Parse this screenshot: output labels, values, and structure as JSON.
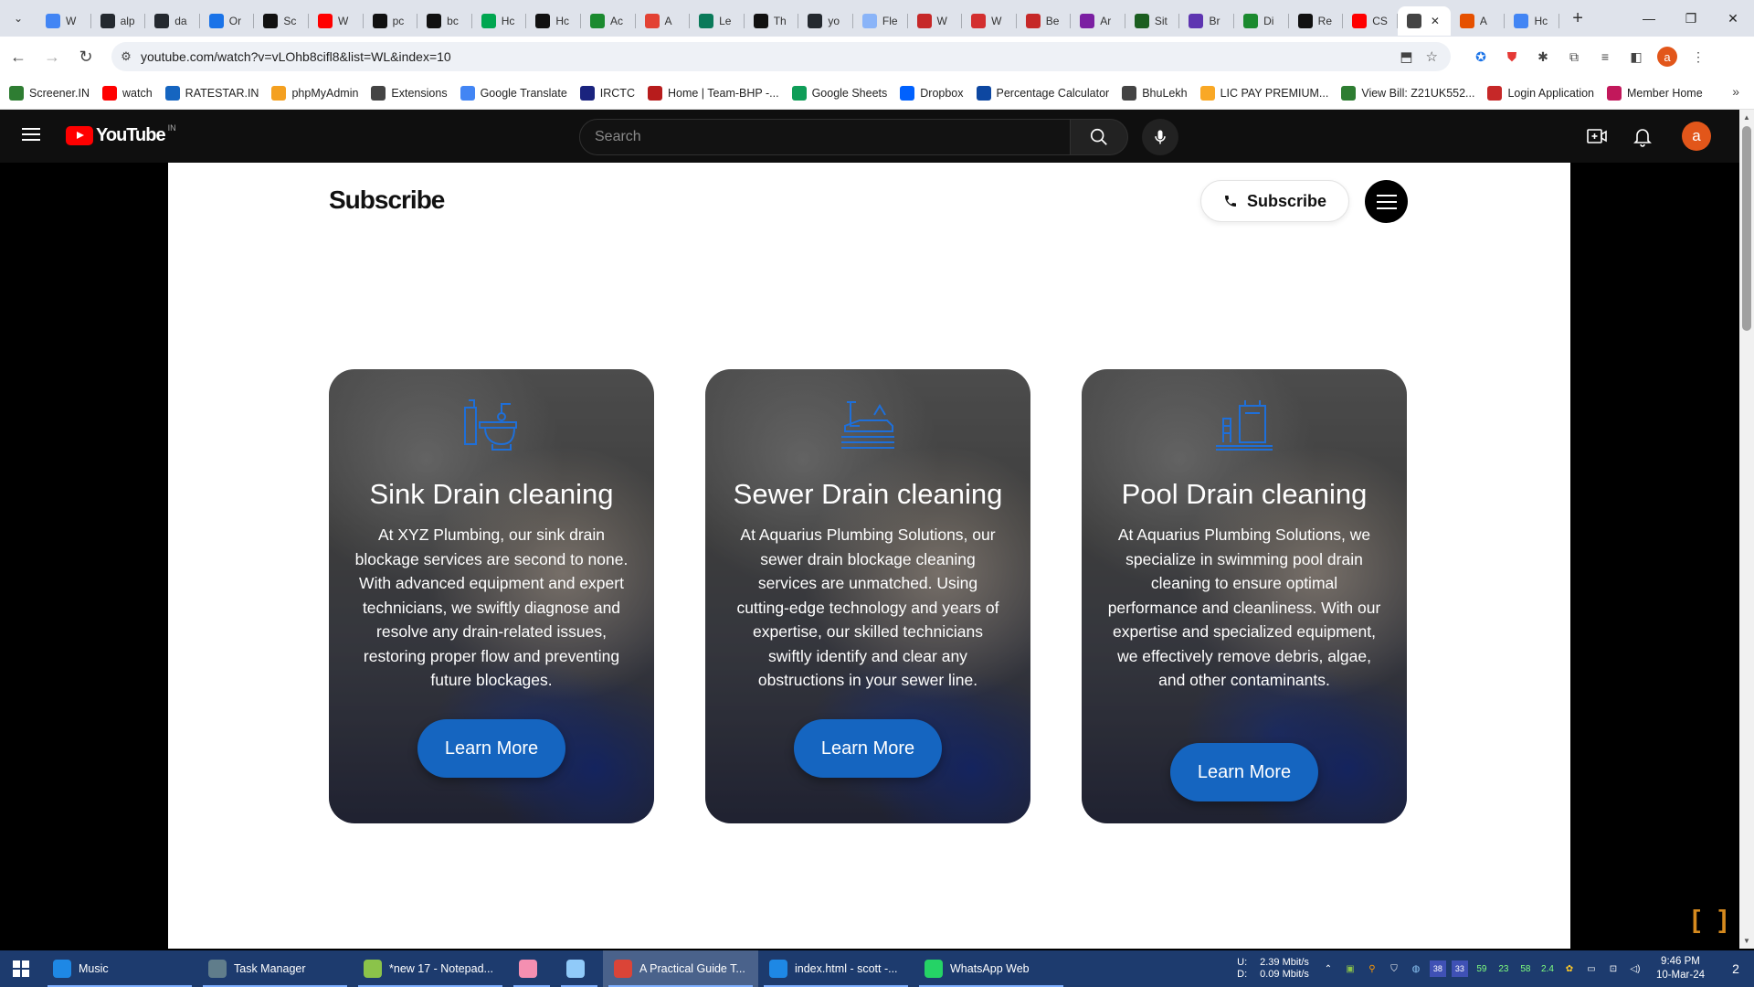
{
  "browser": {
    "tabs": [
      {
        "label": "W",
        "icon": "google-icon",
        "color": "#4285f4"
      },
      {
        "label": "alp",
        "icon": "github-icon",
        "color": "#24292f"
      },
      {
        "label": "da",
        "icon": "github-icon",
        "color": "#24292f"
      },
      {
        "label": "Or",
        "icon": "circle-a-icon",
        "color": "#1a73e8"
      },
      {
        "label": "Sc",
        "icon": "s-icon",
        "color": "#111111"
      },
      {
        "label": "W",
        "icon": "youtube-icon",
        "color": "#ff0000"
      },
      {
        "label": "pc",
        "icon": "medium-icon",
        "color": "#111111"
      },
      {
        "label": "bc",
        "icon": "medium-icon",
        "color": "#111111"
      },
      {
        "label": "Hc",
        "icon": "w-icon",
        "color": "#00a650"
      },
      {
        "label": "Hc",
        "icon": "a-icon",
        "color": "#111111"
      },
      {
        "label": "Ac",
        "icon": "link-icon",
        "color": "#1b8a2f"
      },
      {
        "label": "A",
        "icon": "star-icon",
        "color": "#e34234"
      },
      {
        "label": "Le",
        "icon": "leaf-icon",
        "color": "#0a7a5a"
      },
      {
        "label": "Th",
        "icon": "dev-icon",
        "color": "#111111"
      },
      {
        "label": "yo",
        "icon": "github-icon",
        "color": "#24292f"
      },
      {
        "label": "Fle",
        "icon": "swirl-icon",
        "color": "#8ab4f8"
      },
      {
        "label": "W",
        "icon": "nn-icon",
        "color": "#c62828"
      },
      {
        "label": "W",
        "icon": "ring-icon",
        "color": "#d32f2f"
      },
      {
        "label": "Be",
        "icon": "nn-icon",
        "color": "#c62828"
      },
      {
        "label": "Ar",
        "icon": "butterfly-icon",
        "color": "#7b1fa2"
      },
      {
        "label": "Sit",
        "icon": "n-icon",
        "color": "#1b5e20"
      },
      {
        "label": "Br",
        "icon": "b-icon",
        "color": "#5e35b1"
      },
      {
        "label": "Di",
        "icon": "link-icon",
        "color": "#1b8a2f"
      },
      {
        "label": "Re",
        "icon": "medium-icon",
        "color": "#111111"
      },
      {
        "label": "CS",
        "icon": "youtube-icon",
        "color": "#ff0000"
      },
      {
        "label": "",
        "icon": "speaker-icon",
        "color": "#444444",
        "active": true
      },
      {
        "label": "A",
        "icon": "html-icon",
        "color": "#e65100"
      },
      {
        "label": "Hc",
        "icon": "google-icon",
        "color": "#4285f4"
      }
    ],
    "active_tab_close": "✕",
    "new_tab": "+",
    "window_controls": {
      "minimize": "—",
      "maximize": "❐",
      "close": "✕"
    },
    "url": "youtube.com/watch?v=vLOhb8cifl8&list=WL&index=10",
    "bookmarks": [
      {
        "label": "Screener.IN",
        "icon": "bars-icon",
        "color": "#2e7d32"
      },
      {
        "label": "watch",
        "icon": "youtube-icon",
        "color": "#ff0000"
      },
      {
        "label": "RATESTAR.IN",
        "icon": "r-icon",
        "color": "#1565c0"
      },
      {
        "label": "phpMyAdmin",
        "icon": "sail-icon",
        "color": "#f4a020"
      },
      {
        "label": "Extensions",
        "icon": "puzzle-icon",
        "color": "#444444"
      },
      {
        "label": "Google Translate",
        "icon": "translate-icon",
        "color": "#4285f4"
      },
      {
        "label": "IRCTC",
        "icon": "irctc-icon",
        "color": "#1a237e"
      },
      {
        "label": "Home | Team-BHP -...",
        "icon": "bhp-icon",
        "color": "#b71c1c"
      },
      {
        "label": "Google Sheets",
        "icon": "sheets-icon",
        "color": "#0f9d58"
      },
      {
        "label": "Dropbox",
        "icon": "dropbox-icon",
        "color": "#0061fe"
      },
      {
        "label": "Percentage Calculator",
        "icon": "percent-icon",
        "color": "#0d47a1"
      },
      {
        "label": "BhuLekh",
        "icon": "globe-icon",
        "color": "#444444"
      },
      {
        "label": "LIC PAY PREMIUM...",
        "icon": "lic-icon",
        "color": "#f9a825"
      },
      {
        "label": "View Bill: Z21UK552...",
        "icon": "bill-icon",
        "color": "#2e7d32"
      },
      {
        "label": "Login Application",
        "icon": "login-icon",
        "color": "#c62828"
      },
      {
        "label": "Member Home",
        "icon": "member-icon",
        "color": "#c2185b"
      }
    ],
    "bookmarks_more": "»"
  },
  "youtube": {
    "logo_text": "YouTube",
    "country": "IN",
    "search_placeholder": "Search",
    "avatar_letter": "a"
  },
  "site": {
    "logo": "Subscribe",
    "subscribe_label": "Subscribe",
    "cards": [
      {
        "title": "Sink Drain cleaning",
        "text": "At XYZ Plumbing, our sink drain blockage services are second to none. With advanced equipment and expert technicians, we swiftly diagnose and resolve any drain-related issues, restoring proper flow and preventing future blockages.",
        "button": "Learn More",
        "icon": "sink-icon"
      },
      {
        "title": "Sewer Drain cleaning",
        "text": "At Aquarius Plumbing Solutions, our sewer drain blockage cleaning services are unmatched. Using cutting-edge technology and years of expertise, our skilled technicians swiftly identify and clear any obstructions in your sewer line.",
        "button": "Learn More",
        "icon": "sewer-icon"
      },
      {
        "title": "Pool Drain cleaning",
        "text": "At Aquarius Plumbing Solutions, we specialize in swimming pool drain cleaning to ensure optimal performance and cleanliness. With our expertise and specialized equipment, we effectively remove debris, algae, and other contaminants.",
        "button": "Learn More",
        "icon": "pool-icon"
      }
    ],
    "button_color": "#1565c0",
    "icon_color": "#1e6fd9",
    "corner_icon": "[ ]"
  },
  "taskbar": {
    "items": [
      {
        "label": "Music",
        "icon": "music-icon",
        "color": "#1e88e5"
      },
      {
        "label": "Task Manager",
        "icon": "task-manager-icon",
        "color": "#607d8b"
      },
      {
        "label": "*new 17 - Notepad...",
        "icon": "notepad-icon",
        "color": "#8bc34a"
      },
      {
        "label": "",
        "icon": "face-icon",
        "color": "#f48fb1"
      },
      {
        "label": "",
        "icon": "document-icon",
        "color": "#90caf9"
      },
      {
        "label": "A Practical Guide T...",
        "icon": "chrome-icon",
        "color": "#db4437",
        "active": true
      },
      {
        "label": "index.html - scott -...",
        "icon": "vscode-icon",
        "color": "#1e88e5"
      },
      {
        "label": "WhatsApp Web",
        "icon": "whatsapp-icon",
        "color": "#25d366"
      }
    ],
    "net_up_label": "U:",
    "net_up": "2.39 Mbit/s",
    "net_down_label": "D:",
    "net_down": "0.09 Mbit/s",
    "tray_numbers": [
      "59",
      "23",
      "58",
      "2.4"
    ],
    "tray_badges": [
      "38",
      "33"
    ],
    "time": "9:46 PM",
    "date": "10-Mar-24",
    "notification_count": "2"
  }
}
